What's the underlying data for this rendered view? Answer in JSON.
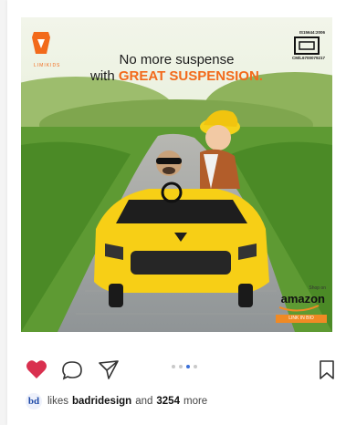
{
  "post": {
    "headline_line1": "No more suspense",
    "headline_line2_prefix": "with",
    "headline_line2_accent": "GREAT SUSPENSION.",
    "brand_logo_text": "LIMIKIDS",
    "certification_top": "IS15644:2006",
    "certification_bottom": "CM/L6700079217",
    "shop_on_label": "Shop on",
    "amazon_label": "amazon",
    "link_in_bio_label": "LINK IN BIO"
  },
  "colors": {
    "accent_orange": "#f26a1b",
    "like_heart": "#d9304f",
    "carousel_active": "#3a6fd8",
    "car_yellow": "#f7cf16"
  },
  "actions": {
    "like_icon": "heart-icon",
    "comment_icon": "comment-icon",
    "share_icon": "send-icon",
    "save_icon": "bookmark-icon"
  },
  "carousel": {
    "total": 4,
    "active_index": 2
  },
  "likes": {
    "prefix": "likes",
    "user": "badridesign",
    "connector": "and",
    "count": "3254",
    "suffix": "more",
    "avatar_initials": "bd"
  }
}
